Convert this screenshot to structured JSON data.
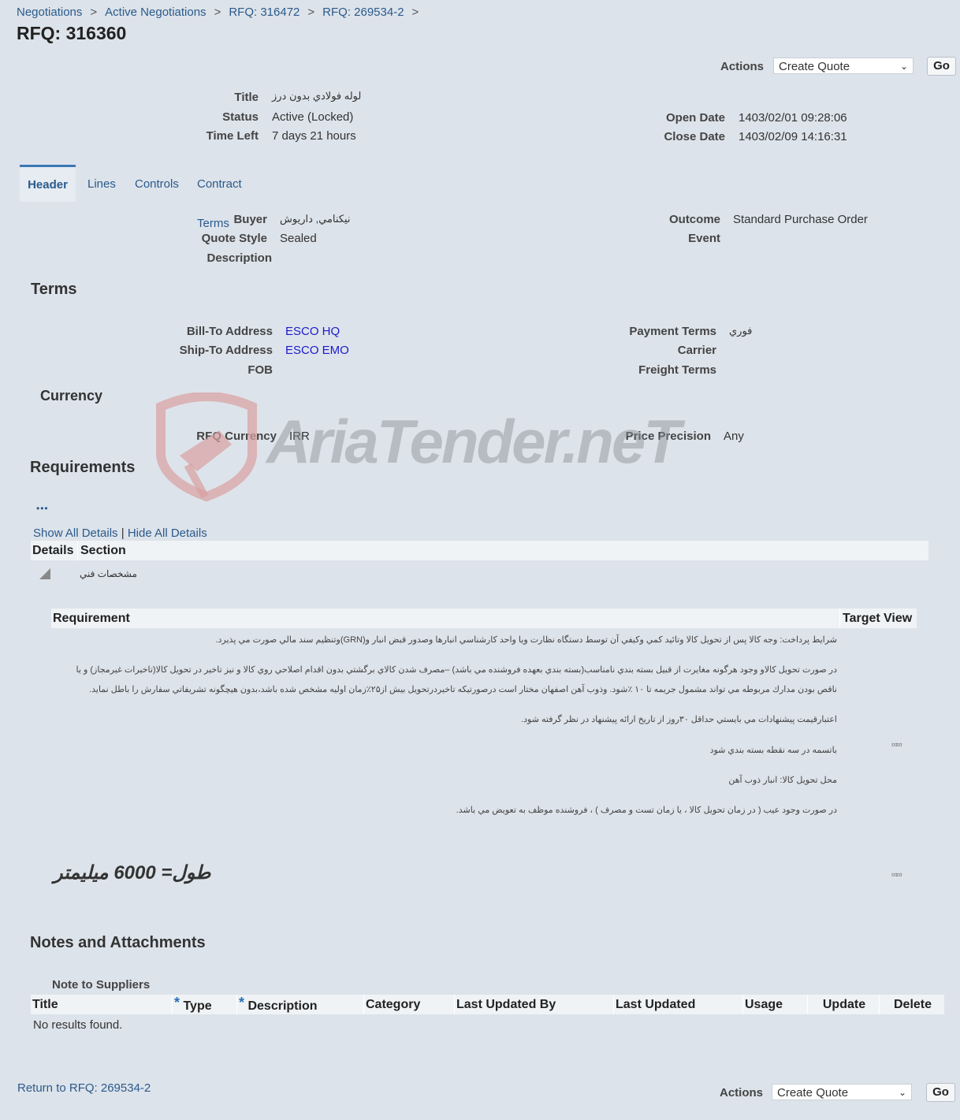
{
  "breadcrumb": [
    "Negotiations",
    "Active Negotiations",
    "RFQ: 316472",
    "RFQ: 269534-2"
  ],
  "breadcrumb_separator": ">",
  "page_title": "RFQ: 316360",
  "actions": {
    "label": "Actions",
    "selected": "Create Quote",
    "go": "Go"
  },
  "summary": {
    "title_label": "Title",
    "title_value": "لوله فولادي بدون درز",
    "status_label": "Status",
    "status_value": "Active (Locked)",
    "time_left_label": "Time Left",
    "time_left_value": "7 days 21 hours",
    "open_date_label": "Open Date",
    "open_date_value": "1403/02/01 09:28:06",
    "close_date_label": "Close Date",
    "close_date_value": "1403/02/09 14:16:31"
  },
  "tabs": [
    "Header",
    "Lines",
    "Controls",
    "Contract Terms"
  ],
  "header": {
    "buyer_label": "Buyer",
    "buyer_value": "نيكنامي, داريوش",
    "quote_style_label": "Quote Style",
    "quote_style_value": "Sealed",
    "description_label": "Description",
    "outcome_label": "Outcome",
    "outcome_value": "Standard Purchase Order",
    "event_label": "Event"
  },
  "terms": {
    "heading": "Terms",
    "bill_to_label": "Bill-To Address",
    "bill_to_value": "ESCO HQ",
    "ship_to_label": "Ship-To Address",
    "ship_to_value": "ESCO EMO",
    "fob_label": "FOB",
    "payment_terms_label": "Payment Terms",
    "payment_terms_value": "فوري",
    "carrier_label": "Carrier",
    "freight_terms_label": "Freight Terms"
  },
  "currency": {
    "heading": "Currency",
    "rfq_currency_label": "RFQ Currency",
    "rfq_currency_value": "IRR",
    "price_precision_label": "Price Precision",
    "price_precision_value": "Any"
  },
  "watermark": "AriaTender.neT",
  "requirements": {
    "heading": "Requirements",
    "more": "•••",
    "show_all": "Show All Details",
    "divider": "|",
    "hide_all": "Hide All Details",
    "cols": [
      "Details",
      "Section"
    ],
    "section_name": "مشخصات فني",
    "req_cols": [
      "Requirement",
      "Target",
      "View"
    ],
    "lines": [
      "شرايط پرداخت: وجه كالا پس از تحويل كالا وتائيد كمي وكيفي آن توسط دستگاه نظارت ويا واحد كارشناسي انبارها وصدور قبض انبار و(GRN)وتنظيم سند مالي صورت مي پذيرد.",
      "در صورت تحويل كالاو وجود هرگونه مغايرت از قبيل بسته بندي نامناسب(بسته بندي بعهده فروشنده مي باشد) –مصرف شدن كالاي برگشتي بدون اقدام اصلاحي روي كالا و نيز تاخير در تحويل كالا(تاخيرات غيرمجاز) و يا",
      "ناقص بودن مدارك مربوطه مي تواند مشمول جريمه تا ۱۰ ٪شود. وذوب آهن اصفهان مختار است درصورتيكه تاخيردرتحويل بيش از۲۵٪زمان اوليه مشخص شده باشد،بدون هيچگونه تشريفاتي سفارش را باطل نمايد.",
      "اعتبارقيمت پيشنهادات مي بايستي حداقل ۳۰روز از تاريخ ارائه پيشنهاد در نظر گرفته شود.",
      "باتسمه در سه نقطه بسته بندي شود",
      "محل تحويل كالا:   انبار ذوب آهن",
      "در صورت وجود عيب ( در زمان تحويل كالا ، يا زمان تست و مصرف ) ، فروشنده موظف به تعويض مي باشد."
    ],
    "length_req": "طول= 6000 ميليمتر"
  },
  "notes": {
    "heading": "Notes and Attachments",
    "note_to_suppliers": "Note to Suppliers",
    "cols": [
      "Title",
      "Type",
      "Description",
      "Category",
      "Last Updated By",
      "Last Updated",
      "Usage",
      "Update",
      "Delete"
    ],
    "required_marker": "*",
    "empty": "No results found."
  },
  "return_link": "Return to RFQ: 269534-2"
}
